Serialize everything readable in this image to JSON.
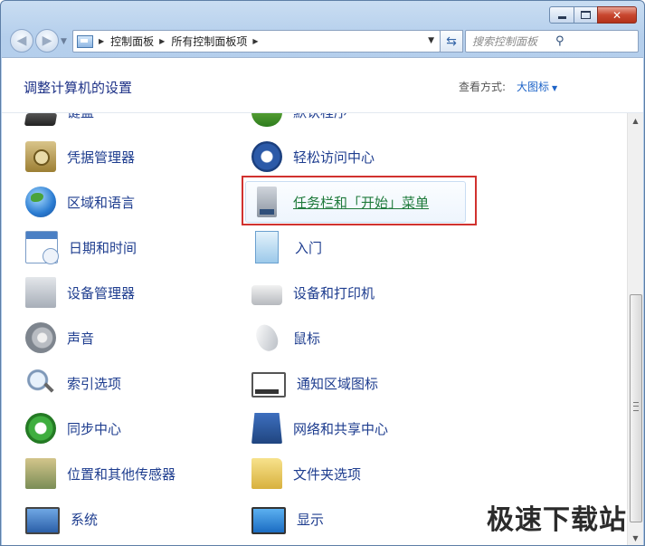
{
  "window": {
    "minimize_icon": "minimize-icon",
    "maximize_icon": "maximize-icon",
    "close_icon": "close-icon"
  },
  "nav": {
    "breadcrumb": [
      "控制面板",
      "所有控制面板项"
    ],
    "search_placeholder": "搜索控制面板"
  },
  "header": {
    "title": "调整计算机的设置",
    "view_by_label": "查看方式:",
    "view_by_value": "大图标"
  },
  "items": {
    "left": [
      "键盘",
      "凭据管理器",
      "区域和语言",
      "日期和时间",
      "设备管理器",
      "声音",
      "索引选项",
      "同步中心",
      "位置和其他传感器",
      "系统"
    ],
    "right": [
      "默认程序",
      "轻松访问中心",
      "任务栏和「开始」菜单",
      "入门",
      "设备和打印机",
      "鼠标",
      "通知区域图标",
      "网络和共享中心",
      "文件夹选项",
      "显示"
    ]
  },
  "watermark": "极速下载站",
  "colors": {
    "link": "#1e3d8f",
    "highlight_border": "#d1322f",
    "hover_link": "#1f7a3b"
  }
}
